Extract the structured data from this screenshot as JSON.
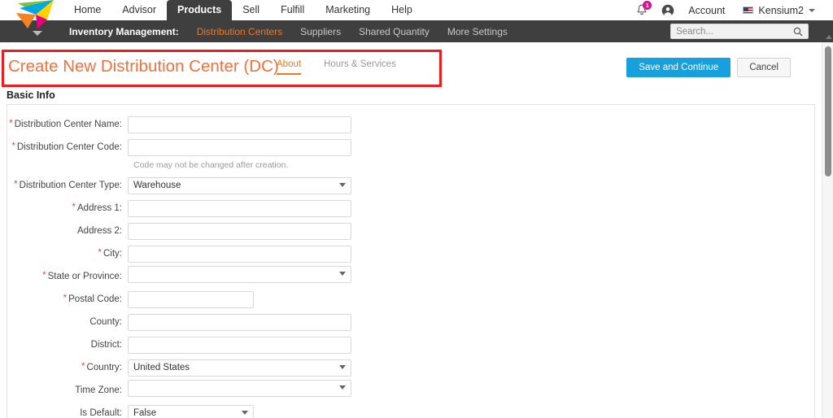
{
  "brand": {
    "logo_icon": "pinwheel-logo-icon",
    "logo_chevron_icon": "chevron-down-icon",
    "accent_orange": "#f07820",
    "title_orange": "#f2713b",
    "primary_blue": "#17a0dd",
    "nav_dark": "#3f3f3f",
    "badge_magenta": "#d6108f",
    "annotation_red": "#ee1c1c"
  },
  "topnav": {
    "items": [
      {
        "label": "Home",
        "active": false
      },
      {
        "label": "Advisor",
        "active": false
      },
      {
        "label": "Products",
        "active": true
      },
      {
        "label": "Sell",
        "active": false
      },
      {
        "label": "Fulfill",
        "active": false
      },
      {
        "label": "Marketing",
        "active": false
      },
      {
        "label": "Help",
        "active": false
      }
    ],
    "notification": {
      "icon": "bell-icon",
      "count": "1"
    },
    "avatar_icon": "account-avatar-icon",
    "account_label": "Account",
    "flag_icon": "us-flag-icon",
    "user_label": "Kensium2",
    "user_caret_icon": "chevron-down-icon"
  },
  "subnav": {
    "section_label": "Inventory Management:",
    "items": [
      {
        "label": "Distribution Centers",
        "active": true
      },
      {
        "label": "Suppliers",
        "active": false
      },
      {
        "label": "Shared Quantity",
        "active": false
      },
      {
        "label": "More Settings",
        "active": false
      }
    ],
    "search": {
      "placeholder": "Search...",
      "value": "",
      "icon": "search-icon"
    }
  },
  "page": {
    "title": "Create New Distribution Center (DC)",
    "tabs": [
      {
        "label": "About",
        "active": true
      },
      {
        "label": "Hours & Services",
        "active": false
      }
    ],
    "actions": {
      "save_label": "Save and Continue",
      "cancel_label": "Cancel"
    },
    "section_heading": "Basic Info"
  },
  "form": {
    "fields": [
      {
        "label": "Distribution Center Name:",
        "required": true,
        "type": "text",
        "value": "",
        "width": "wide",
        "name": "distribution-center-name-input"
      },
      {
        "label": "Distribution Center Code:",
        "required": true,
        "type": "text",
        "value": "",
        "width": "wide",
        "hint": "Code may not be changed after creation.",
        "name": "distribution-center-code-input"
      },
      {
        "label": "Distribution Center Type:",
        "required": true,
        "type": "select",
        "value": "Warehouse",
        "width": "wide",
        "name": "distribution-center-type-select"
      },
      {
        "label": "Address 1:",
        "required": true,
        "type": "text",
        "value": "",
        "width": "wide",
        "name": "address-1-input"
      },
      {
        "label": "Address 2:",
        "required": false,
        "type": "text",
        "value": "",
        "width": "wide",
        "name": "address-2-input"
      },
      {
        "label": "City:",
        "required": true,
        "type": "text",
        "value": "",
        "width": "wide",
        "name": "city-input"
      },
      {
        "label": "State or Province:",
        "required": true,
        "type": "select",
        "value": "",
        "width": "wide",
        "name": "state-or-province-select"
      },
      {
        "label": "Postal Code:",
        "required": true,
        "type": "text",
        "value": "",
        "width": "narrow",
        "name": "postal-code-input"
      },
      {
        "label": "County:",
        "required": false,
        "type": "text",
        "value": "",
        "width": "wide",
        "name": "county-input"
      },
      {
        "label": "District:",
        "required": false,
        "type": "text",
        "value": "",
        "width": "wide",
        "name": "district-input"
      },
      {
        "label": "Country:",
        "required": true,
        "type": "select",
        "value": "United States",
        "width": "wide",
        "name": "country-select"
      },
      {
        "label": "Time Zone:",
        "required": false,
        "type": "select",
        "value": "",
        "width": "wide",
        "name": "time-zone-select"
      },
      {
        "label": "Is Default:",
        "required": false,
        "type": "select",
        "value": "False",
        "width": "narrow",
        "name": "is-default-select"
      }
    ]
  },
  "scrollbar": {
    "vertical_thumb_icon": "scrollbar-thumb",
    "up_arrow_icon": "scroll-up-arrow-icon"
  }
}
